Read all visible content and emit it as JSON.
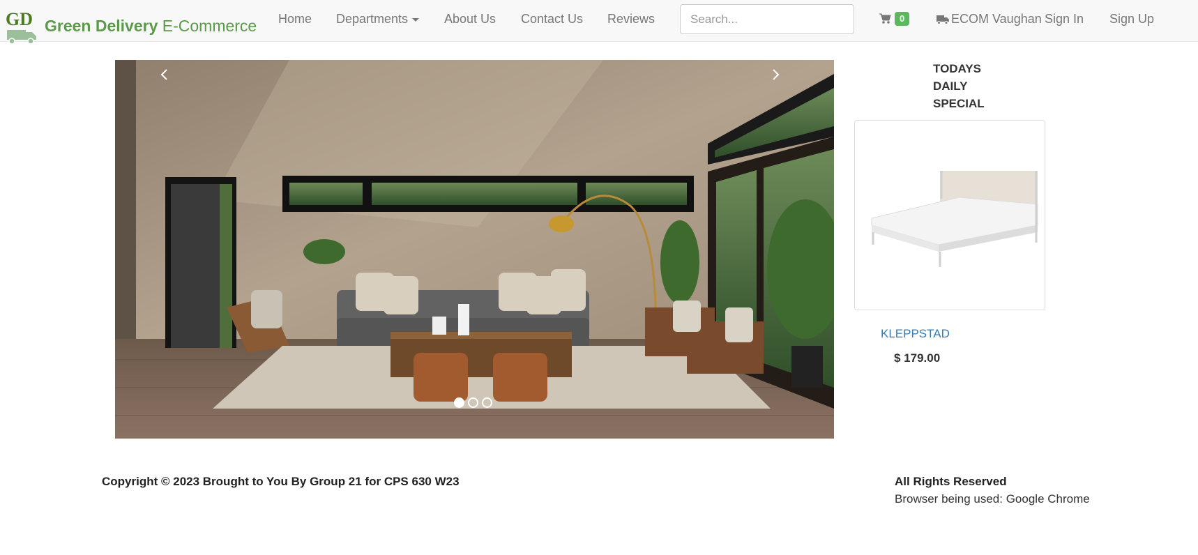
{
  "brand": {
    "logo_text": "GD",
    "name_bold": "Green Delivery",
    "name_rest": " E-Commerce"
  },
  "nav": {
    "home": "Home",
    "departments": "Departments",
    "about": "About Us",
    "contact": "Contact Us",
    "reviews": "Reviews",
    "search_placeholder": "Search...",
    "cart_count": "0",
    "store": "ECOM Vaughan",
    "sign_in": "Sign In",
    "sign_up": "Sign Up"
  },
  "carousel": {
    "slide_count": 3,
    "active_slide": 1
  },
  "special": {
    "title": "TODAYS DAILY SPECIAL",
    "product_name": "KLEPPSTAD",
    "price": "$ 179.00"
  },
  "footer": {
    "copyright": "Copyright © 2023 Brought to You By Group 21 for CPS 630 W23",
    "rights": "All Rights Reserved",
    "browser": "Browser being used: Google Chrome"
  },
  "colors": {
    "brand_green": "#5a9a4a",
    "badge_green": "#5cb85c",
    "link_blue": "#337ab7",
    "navbar_bg": "#f8f8f8"
  },
  "icons": {
    "cart": "shopping-cart-icon",
    "store": "truck-icon",
    "prev": "chevron-left-icon",
    "next": "chevron-right-icon"
  }
}
